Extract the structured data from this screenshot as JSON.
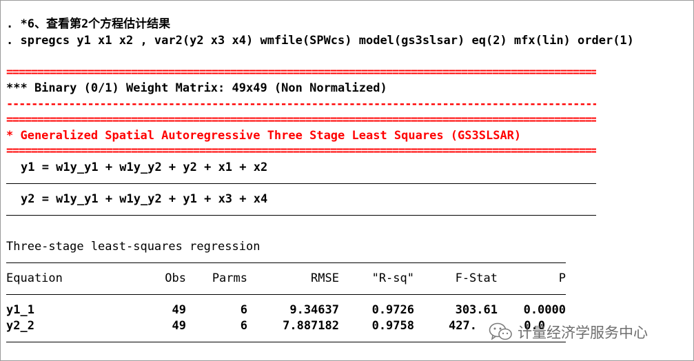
{
  "commands": {
    "comment": ". *6、查看第2个方程估计结果",
    "command": ". spregcs y1 x1 x2 , var2(y2 x3 x4) wmfile(SPWcs) model(gs3slsar) eq(2) mfx(lin) order(1)"
  },
  "output": {
    "double_rule": "====================================================================================================",
    "single_rule": "----------------------------------------------------------------------------------------------------",
    "weight_matrix": "*** Binary (0/1) Weight Matrix: 49x49 (Non Normalized)",
    "model_title": "* Generalized Spatial Autoregressive Three Stage Least Squares (GS3SLSAR)",
    "equations": [
      "y1 = w1y_y1 + w1y_y2 + y2 + x1 + x2",
      "y2 = w1y_y1 + w1y_y2 + y1 + x3 + x4"
    ]
  },
  "regression": {
    "title": "Three-stage least-squares regression",
    "headers": {
      "equation": "Equation",
      "obs": "Obs",
      "parms": "Parms",
      "rmse": "RMSE",
      "rsq": "\"R-sq\"",
      "fstat": "F-Stat",
      "p": "P"
    },
    "rows": [
      {
        "equation": "y1_1",
        "obs": "49",
        "parms": "6",
        "rmse": "9.34637",
        "rsq": "0.9726",
        "fstat": "303.61",
        "p": "0.0000"
      },
      {
        "equation": "y2_2",
        "obs": "49",
        "parms": "6",
        "rmse": "7.887182",
        "rsq": "0.9758",
        "fstat": "427.",
        "p": "0.0"
      }
    ]
  },
  "watermark": {
    "icon": "wechat-icon",
    "text": "计量经济学服务中心"
  }
}
